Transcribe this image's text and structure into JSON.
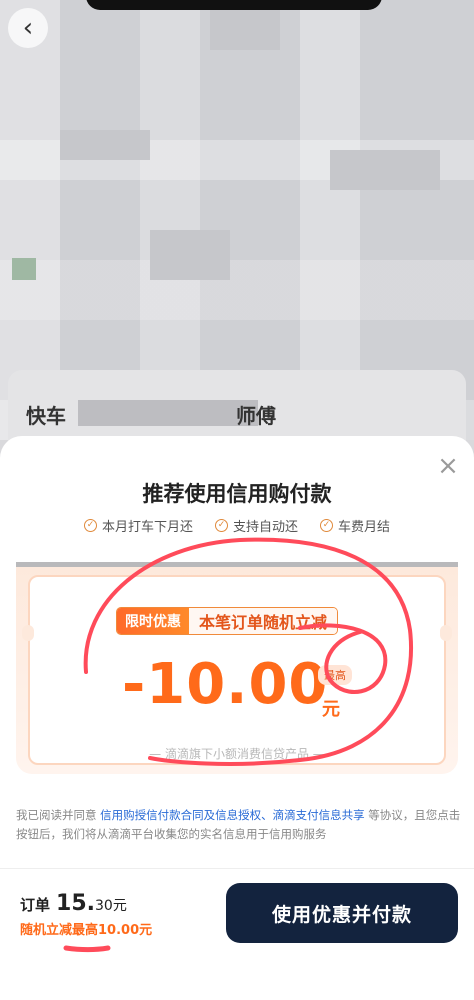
{
  "topbar": {
    "back_glyph": "‹"
  },
  "driver": {
    "name_prefix": "快车",
    "name_suffix": "师傅"
  },
  "sheet": {
    "close_glyph": "×",
    "title": "推荐使用信用购付款",
    "features": [
      "本月打车下月还",
      "支持自动还",
      "车费月结"
    ],
    "promo": {
      "tag": "限时优惠",
      "text": "本笔订单随机立减",
      "amount": "-10.00",
      "unit": "元",
      "max_badge": "最高",
      "note": "— 滴滴旗下小额消费信贷产品 —"
    },
    "agreement": {
      "prefix": "我已阅读并同意 ",
      "links": "信用购授信付款合同及信息授权、滴滴支付信息共享",
      "suffix": " 等协议，且您点击按钮后，我们将从滴滴平台收集您的实名信息用于信用购服务"
    }
  },
  "footer": {
    "order_label": "订单",
    "order_amount_int": "15.",
    "order_amount_cents": "30",
    "order_unit": "元",
    "random_discount": "随机立减最高10.00元",
    "pay_button": "使用优惠并付款"
  },
  "colors": {
    "accent": "#ff6a1a",
    "button": "#13233e",
    "link": "#2a6bd6",
    "scribble": "#ff4b5a"
  },
  "icons": [
    "back-arrow-icon",
    "close-icon",
    "check-circle-icon"
  ]
}
